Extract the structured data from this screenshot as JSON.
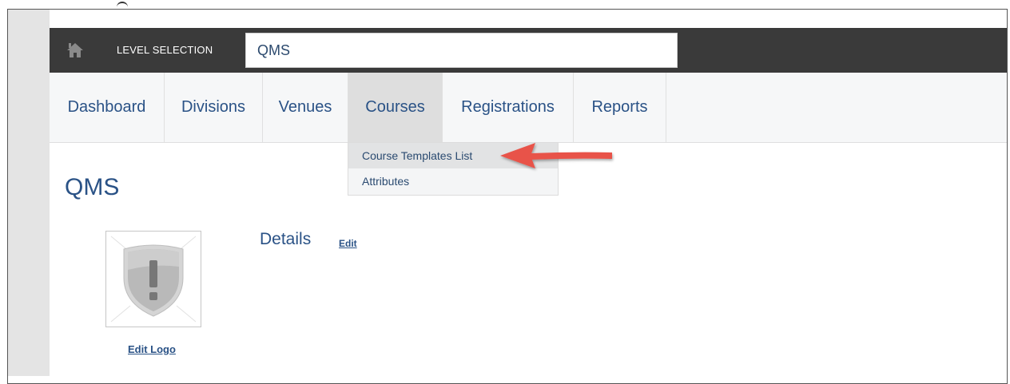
{
  "topbar": {
    "home_icon": "home-icon",
    "level_label": "LEVEL SELECTION",
    "level_value": "QMS",
    "background_color": "#3a3a3a"
  },
  "nav": {
    "items": [
      {
        "label": "Dashboard",
        "active": false
      },
      {
        "label": "Divisions",
        "active": false
      },
      {
        "label": "Venues",
        "active": false
      },
      {
        "label": "Courses",
        "active": true
      },
      {
        "label": "Registrations",
        "active": false
      },
      {
        "label": "Reports",
        "active": false
      }
    ]
  },
  "dropdown": {
    "items": [
      {
        "label": "Course Templates List",
        "highlighted": true
      },
      {
        "label": "Attributes",
        "highlighted": false
      }
    ]
  },
  "annotation": {
    "arrow_color": "#e8534a",
    "points_to": "Course Templates List"
  },
  "page": {
    "title": "QMS",
    "logo_icon": "shield-exclamation-icon",
    "edit_logo_label": "Edit Logo",
    "details_title": "Details",
    "details_edit_label": "Edit"
  },
  "colors": {
    "link_blue": "#2a5286",
    "nav_active_bg": "#dedede"
  }
}
